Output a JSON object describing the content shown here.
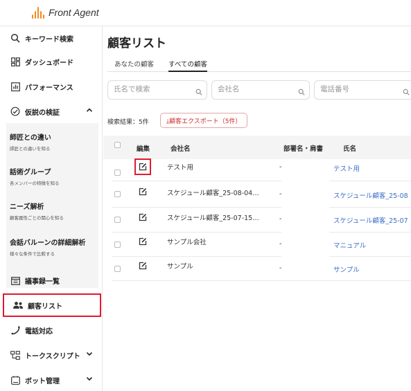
{
  "app": {
    "name": "Front Agent"
  },
  "sidebar": {
    "items": [
      {
        "label": "キーワード検索",
        "icon": "search-icon"
      },
      {
        "label": "ダッシュボード",
        "icon": "dashboard-icon"
      },
      {
        "label": "パフォーマンス",
        "icon": "bar-chart-icon"
      },
      {
        "label": "仮説の検証",
        "icon": "verify-icon",
        "expanded": true
      },
      {
        "label": "議事録一覧",
        "icon": "calendar-icon"
      },
      {
        "label": "顧客リスト",
        "icon": "users-icon",
        "active": true
      },
      {
        "label": "電話対応",
        "icon": "phone-icon"
      },
      {
        "label": "トークスクリプト",
        "icon": "script-icon"
      },
      {
        "label": "ボット管理",
        "icon": "bot-icon"
      }
    ],
    "subitems": [
      {
        "title": "師匠との違い",
        "desc": "師匠との違いを知る"
      },
      {
        "title": "話術グループ",
        "desc": "各メンバーの特徴を知る"
      },
      {
        "title": "ニーズ解析",
        "desc": "顧客属性ごとの関心を知る"
      },
      {
        "title": "会話バルーンの詳細解析",
        "desc": "様々な条件で比較する"
      }
    ]
  },
  "main": {
    "title": "顧客リスト",
    "tabs": [
      {
        "label": "あなたの顧客"
      },
      {
        "label": "すべての顧客",
        "active": true
      }
    ],
    "filters": [
      {
        "placeholder": "氏名で検索"
      },
      {
        "placeholder": "会社名"
      },
      {
        "placeholder": "電話番号"
      }
    ],
    "result_text": "検索結果：5件",
    "export_label": "⤓顧客エクスポート（5件）",
    "table": {
      "headers": {
        "edit": "編集",
        "company": "会社名",
        "dept": "部署名・肩書",
        "name": "氏名"
      },
      "rows": [
        {
          "company": "テスト用",
          "dept": "-",
          "name": "テスト用"
        },
        {
          "company": "スケジュール顧客_25-08-04…",
          "dept": "-",
          "name": "スケジュール顧客_25-08"
        },
        {
          "company": "スケジュール顧客_25-07-15…",
          "dept": "-",
          "name": "スケジュール顧客_25-07"
        },
        {
          "company": "サンプル会社",
          "dept": "-",
          "name": "マニュアル"
        },
        {
          "company": "サンプル",
          "dept": "-",
          "name": "サンプル"
        }
      ]
    }
  },
  "colors": {
    "brand": "#f28a1b",
    "highlight": "#e0192d",
    "link": "#3a6fc7",
    "export": "#d02a2a"
  }
}
